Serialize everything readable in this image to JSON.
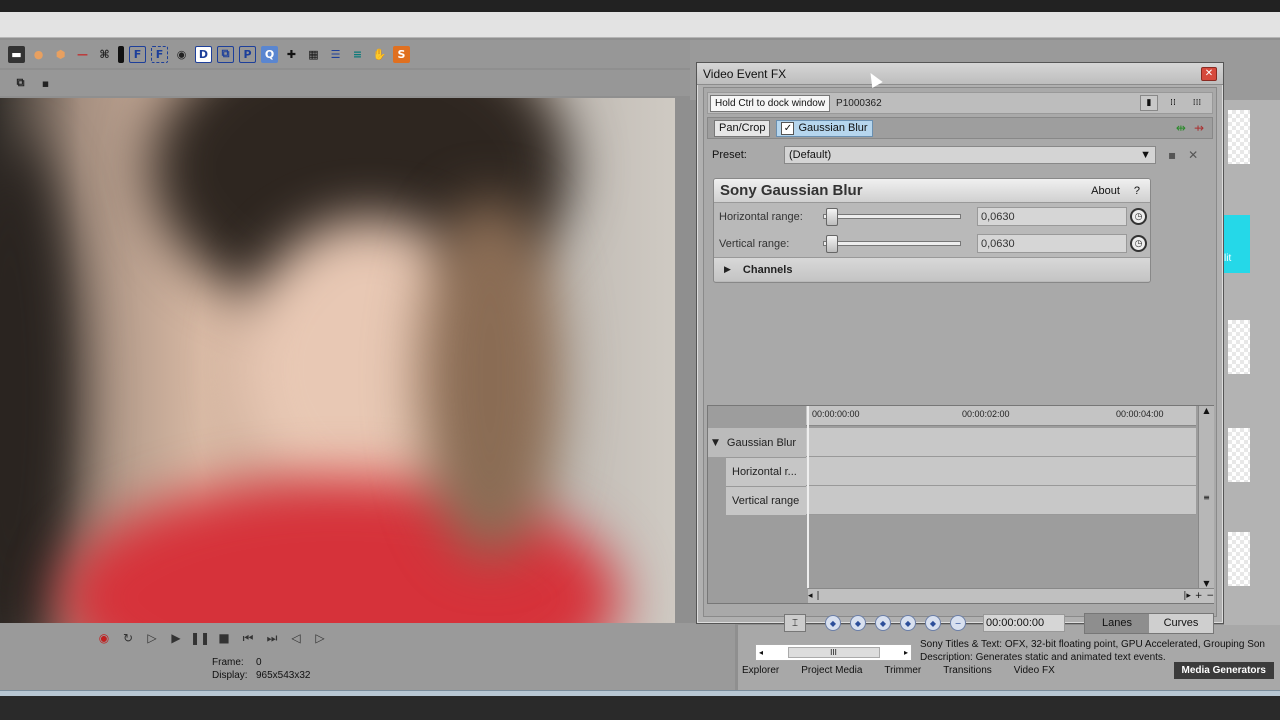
{
  "toolbar_icons": [
    "render-icon",
    "circle-orange-icon",
    "hex-orange-icon",
    "red-line-icon",
    "tool-icon",
    "black-bar-icon",
    "f-icon",
    "f-outline-icon",
    "disc-icon",
    "d-icon",
    "export-icon",
    "p-icon",
    "q-icon",
    "move-icon",
    "film-icon",
    "split-icon",
    "bars-icon",
    "hand-icon",
    "s-icon"
  ],
  "dialog": {
    "title": "Video Event FX",
    "tooltip": "Hold Ctrl to dock window",
    "media_name": "P1000362",
    "chain": {
      "chip1": "Pan/Crop",
      "chip2": "Gaussian Blur"
    },
    "preset_label": "Preset:",
    "preset_value": "(Default)",
    "plugin_title": "Sony Gaussian Blur",
    "about": "About",
    "help": "?",
    "params": [
      {
        "label": "Horizontal range:",
        "value": "0,0630"
      },
      {
        "label": "Vertical range:",
        "value": "0,0630"
      }
    ],
    "channels": "Channels",
    "ruler": [
      "00:00:00:00",
      "00:00:02:00",
      "00:00:04:00"
    ],
    "tracks": [
      "Gaussian Blur",
      "Horizontal r...",
      "Vertical range"
    ],
    "time": "00:00:00:00",
    "lanes": "Lanes",
    "curves": "Curves"
  },
  "frame_info": {
    "frame_label": "Frame:",
    "frame_value": "0",
    "display_label": "Display:",
    "display_value": "965x543x32"
  },
  "description": {
    "line1": "Sony Titles & Text: OFX, 32-bit floating point, GPU Accelerated, Grouping Son",
    "line2": "Description: Generates static and animated text events."
  },
  "bottom_tabs": [
    "Explorer",
    "Project Media",
    "Trimmer",
    "Transitions",
    "Video FX",
    "Media Generators"
  ],
  "side_cyan_text": "lit",
  "scroll_thumb": "III"
}
